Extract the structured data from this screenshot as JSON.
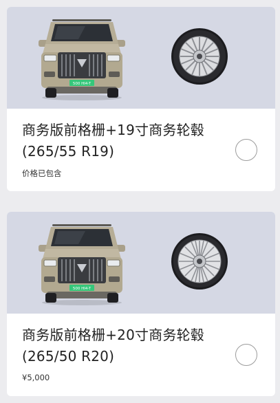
{
  "options": [
    {
      "title_line1": "商务版前格栅+19寸商务轮毂",
      "title_line2": "(265/55 R19)",
      "price": "价格已包含",
      "plate": "500 HI4-T",
      "selected": false
    },
    {
      "title_line1": "商务版前格栅+20寸商务轮毂",
      "title_line2": "(265/50 R20)",
      "price": "¥5,000",
      "plate": "500 HI4-T",
      "selected": false
    }
  ],
  "colors": {
    "banner_bg": "#d5d8e4",
    "car_body": "#b6ad96",
    "plate_green": "#35c77a"
  }
}
